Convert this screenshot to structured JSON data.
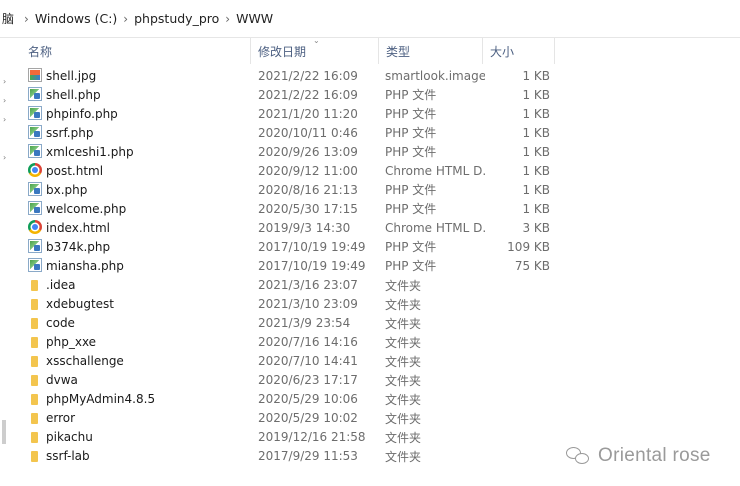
{
  "breadcrumb": {
    "fragment": "脑",
    "segments": [
      "Windows  (C:)",
      "phpstudy_pro",
      "WWW"
    ],
    "separator": "›"
  },
  "columns": {
    "name": "名称",
    "modified": "修改日期",
    "type": "类型",
    "size": "大小"
  },
  "files": [
    {
      "name": "shell.jpg",
      "date": "2021/2/22 16:09",
      "type": "smartlook.image",
      "size": "1 KB",
      "icon": "image-file-icon"
    },
    {
      "name": "shell.php",
      "date": "2021/2/22 16:09",
      "type": "PHP 文件",
      "size": "1 KB",
      "icon": "php-file-icon"
    },
    {
      "name": "phpinfo.php",
      "date": "2021/1/20 11:20",
      "type": "PHP 文件",
      "size": "1 KB",
      "icon": "php-file-icon"
    },
    {
      "name": "ssrf.php",
      "date": "2020/10/11 0:46",
      "type": "PHP 文件",
      "size": "1 KB",
      "icon": "php-file-icon"
    },
    {
      "name": "xmlceshi1.php",
      "date": "2020/9/26 13:09",
      "type": "PHP 文件",
      "size": "1 KB",
      "icon": "php-file-icon"
    },
    {
      "name": "post.html",
      "date": "2020/9/12 11:00",
      "type": "Chrome HTML D...",
      "size": "1 KB",
      "icon": "chrome-html-icon"
    },
    {
      "name": "bx.php",
      "date": "2020/8/16 21:13",
      "type": "PHP 文件",
      "size": "1 KB",
      "icon": "php-file-icon"
    },
    {
      "name": "welcome.php",
      "date": "2020/5/30 17:15",
      "type": "PHP 文件",
      "size": "1 KB",
      "icon": "php-file-icon"
    },
    {
      "name": "index.html",
      "date": "2019/9/3 14:30",
      "type": "Chrome HTML D...",
      "size": "3 KB",
      "icon": "chrome-html-icon"
    },
    {
      "name": "b374k.php",
      "date": "2017/10/19 19:49",
      "type": "PHP 文件",
      "size": "109 KB",
      "icon": "php-file-icon"
    },
    {
      "name": "miansha.php",
      "date": "2017/10/19 19:49",
      "type": "PHP 文件",
      "size": "75 KB",
      "icon": "php-file-icon"
    },
    {
      "name": ".idea",
      "date": "2021/3/16 23:07",
      "type": "文件夹",
      "size": "",
      "icon": "folder-icon"
    },
    {
      "name": "xdebugtest",
      "date": "2021/3/10 23:09",
      "type": "文件夹",
      "size": "",
      "icon": "folder-icon"
    },
    {
      "name": "code",
      "date": "2021/3/9 23:54",
      "type": "文件夹",
      "size": "",
      "icon": "folder-icon"
    },
    {
      "name": "php_xxe",
      "date": "2020/7/16 14:16",
      "type": "文件夹",
      "size": "",
      "icon": "folder-icon"
    },
    {
      "name": "xsschallenge",
      "date": "2020/7/10 14:41",
      "type": "文件夹",
      "size": "",
      "icon": "folder-icon"
    },
    {
      "name": "dvwa",
      "date": "2020/6/23 17:17",
      "type": "文件夹",
      "size": "",
      "icon": "folder-icon"
    },
    {
      "name": "phpMyAdmin4.8.5",
      "date": "2020/5/29 10:06",
      "type": "文件夹",
      "size": "",
      "icon": "folder-icon"
    },
    {
      "name": "error",
      "date": "2020/5/29 10:02",
      "type": "文件夹",
      "size": "",
      "icon": "folder-icon"
    },
    {
      "name": "pikachu",
      "date": "2019/12/16 21:58",
      "type": "文件夹",
      "size": "",
      "icon": "folder-icon"
    },
    {
      "name": "ssrf-lab",
      "date": "2017/9/29 11:53",
      "type": "文件夹",
      "size": "",
      "icon": "folder-icon"
    }
  ],
  "watermark": {
    "text": "Oriental rose",
    "icon": "wechat-icon"
  }
}
